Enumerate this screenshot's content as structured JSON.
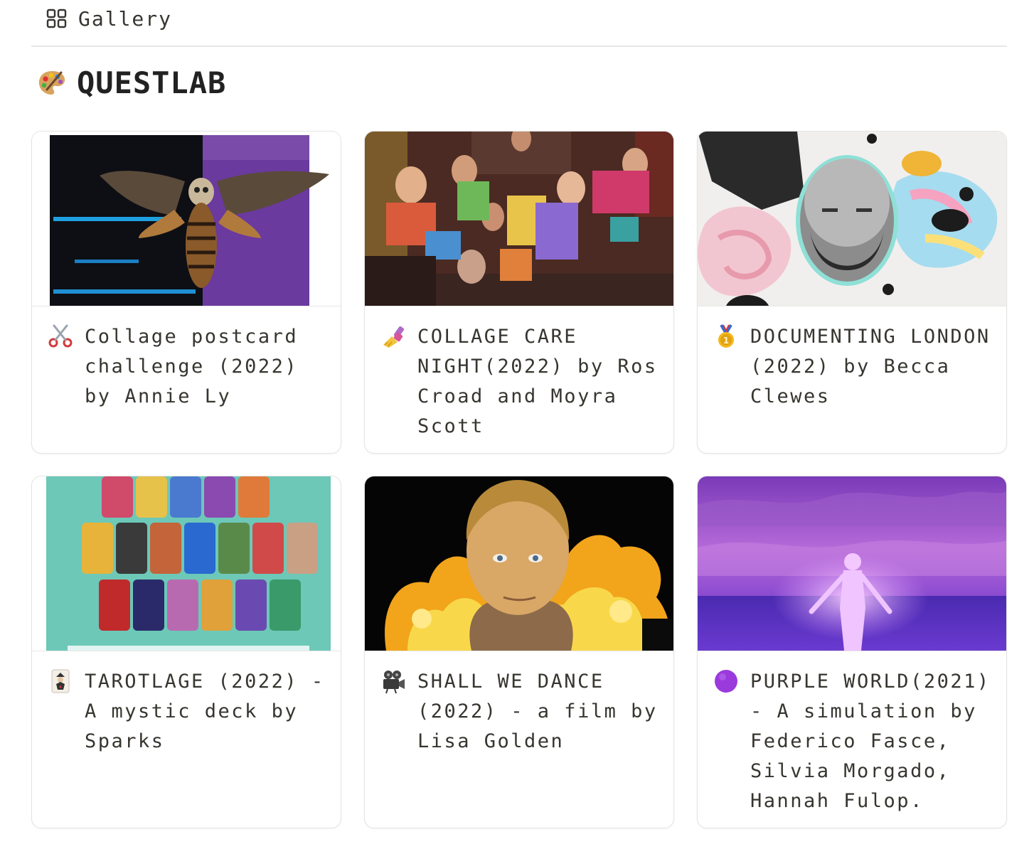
{
  "view": {
    "tab_label": "Gallery",
    "tab_icon": "grid-icon"
  },
  "section": {
    "title": "QUESTLAB",
    "emoji": "artist-palette-icon"
  },
  "cards": [
    {
      "title": "Collage postcard challenge (2022) by Annie Ly",
      "icon": "scissors-icon",
      "cover": "moth-collage-image"
    },
    {
      "title": "COLLAGE CARE NIGHT(2022) by Ros Croad and Moyra Scott",
      "icon": "nail-polish-icon",
      "cover": "group-photo-image"
    },
    {
      "title": "DOCUMENTING LONDON (2022) by Becca Clewes",
      "icon": "gold-medal-icon",
      "cover": "face-collage-image"
    },
    {
      "title": "TAROTLAGE (2022) - A mystic deck by Sparks",
      "icon": "joker-card-icon",
      "cover": "tarot-cards-image"
    },
    {
      "title": "SHALL WE DANCE (2022) - a film by Lisa Golden",
      "icon": "movie-camera-icon",
      "cover": "woman-fire-image"
    },
    {
      "title": "PURPLE WORLD(2021) - A simulation by Federico Fasce, Silvia Morgado, Hannah Fulop.",
      "icon": "purple-circle-icon",
      "cover": "purple-figure-image"
    }
  ]
}
